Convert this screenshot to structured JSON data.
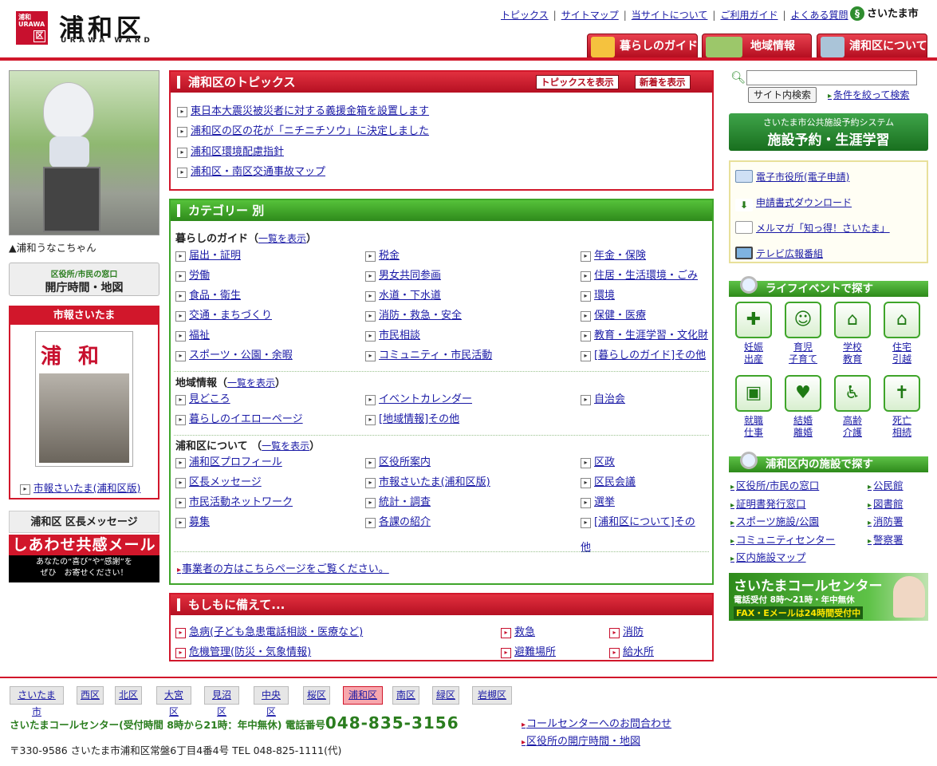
{
  "header": {
    "logo_text": "浦和 URAWA",
    "logo_mark": "区",
    "ward_name": "浦和区",
    "ward_en": "URAWA WARD",
    "top_links": [
      "トピックス",
      "サイトマップ",
      "当サイトについて",
      "ご利用ガイド",
      "よくある質問"
    ],
    "city": "さいたま市",
    "main_tabs": [
      "暮らしのガイド",
      "地域情報",
      "浦和区について"
    ]
  },
  "left": {
    "mascot_caption": "▲浦和うなこちゃん",
    "hours_small": "区役所/市民の窓口",
    "hours_big": "開庁時間・地図",
    "shiho_title": "市報さいたま",
    "shiho_cover": "浦 和",
    "shiho_link": "市報さいたま(浦和区版)",
    "msg_title": "浦和区 区長メッセージ",
    "msg_banner": "しあわせ共感メール",
    "msg_sub1": "あなたの“喜び”や“感謝”を",
    "msg_sub2": "ぜひ　お寄せください！"
  },
  "topics": {
    "title": "浦和区のトピックス",
    "btn_show": "トピックスを表示",
    "btn_new": "新着を表示",
    "items": [
      "東日本大震災被災者に対する義援金箱を設置します",
      "浦和区の区の花が「ニチニチソウ」に決定しました",
      "浦和区環境配慮指針",
      "浦和区・南区交通事故マップ"
    ]
  },
  "category": {
    "title": "カテゴリー 別",
    "show_all": "一覧を表示",
    "sections": [
      {
        "name": "暮らしのガイド",
        "rows": [
          [
            "届出・証明",
            "税金",
            "年金・保険"
          ],
          [
            "労働",
            "男女共同参画",
            "住居・生活環境・ごみ"
          ],
          [
            "食品・衛生",
            "水道・下水道",
            "環境"
          ],
          [
            "交通・まちづくり",
            "消防・救急・安全",
            "保健・医療"
          ],
          [
            "福祉",
            "市民相談",
            "教育・生涯学習・文化財"
          ],
          [
            "スポーツ・公園・余暇",
            "コミュニティ・市民活動",
            "[暮らしのガイド]その他"
          ]
        ]
      },
      {
        "name": "地域情報",
        "rows": [
          [
            "見どころ",
            "イベントカレンダー",
            "自治会"
          ],
          [
            "暮らしのイエローページ",
            "[地域情報]その他",
            ""
          ]
        ]
      },
      {
        "name": "浦和区について",
        "rows": [
          [
            "浦和区プロフィール",
            "区役所案内",
            "区政"
          ],
          [
            "区長メッセージ",
            "市報さいたま(浦和区版)",
            "区民会議"
          ],
          [
            "市民活動ネットワーク",
            "統計・調査",
            "選挙"
          ],
          [
            "募集",
            "各課の紹介",
            "[浦和区について]その"
          ]
        ]
      }
    ],
    "last_wrap": "他",
    "business_link": "事業者の方はこちらページをご覧ください。"
  },
  "emergency": {
    "title": "もしもに備えて...",
    "items": [
      "急病(子ども急患電話相談・医療など)",
      "救急",
      "消防",
      "危機管理(防災・気象情報)",
      "避難場所",
      "給水所"
    ]
  },
  "right": {
    "search_btn": "サイト内検索",
    "adv_search": "条件を絞って検索",
    "facility_small": "さいたま市公共施設予約システム",
    "facility_big": "施設予約・生涯学習",
    "links": [
      "電子市役所(電子申請)",
      "申請書式ダウンロード",
      "メルマガ「知っ得！さいたま」",
      "テレビ広報番組"
    ],
    "life_title": "ライフイベントで探す",
    "life": [
      [
        "妊娠",
        "出産"
      ],
      [
        "育児",
        "子育て"
      ],
      [
        "学校",
        "教育"
      ],
      [
        "住宅",
        "引越"
      ],
      [
        "就職",
        "仕事"
      ],
      [
        "結婚",
        "離婚"
      ],
      [
        "高齢",
        "介護"
      ],
      [
        "死亡",
        "相続"
      ]
    ],
    "facilities_title": "浦和区内の施設で探す",
    "facilities": [
      "区役所/市民の窓口",
      "公民館",
      "証明書発行窓口",
      "図書館",
      "スポーツ施設/公園",
      "消防署",
      "コミュニティセンター",
      "警察署",
      "区内施設マップ"
    ],
    "call_title": "さいたまコールセンター",
    "call_hours": "電話受付 8時～21時・年中無休",
    "call_fax": "FAX・Eメールは24時間受付中"
  },
  "footer": {
    "wards": [
      "さいたま市",
      "西区",
      "北区",
      "大宮区",
      "見沼区",
      "中央区",
      "桜区",
      "浦和区",
      "南区",
      "緑区",
      "岩槻区"
    ],
    "callcenter": "さいたまコールセンター(受付時間 8時から21時：年中無休) 電話番号",
    "phone": "048-835-3156",
    "address": "〒330-9586  さいたま市浦和区常盤6丁目4番4号  TEL  048-825-1111(代)",
    "link_inquiry": "コールセンターへのお問合わせ",
    "link_hours": "区役所の開庁時間・地図"
  }
}
